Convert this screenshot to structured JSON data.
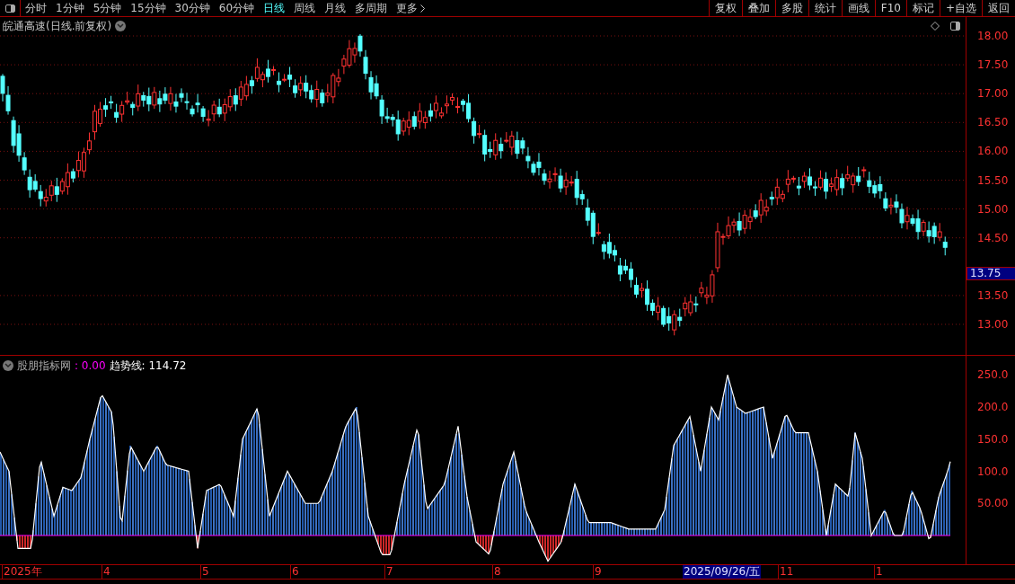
{
  "toolbar": {
    "periods": [
      {
        "label": "分时",
        "selected": false
      },
      {
        "label": "1分钟",
        "selected": false
      },
      {
        "label": "5分钟",
        "selected": false
      },
      {
        "label": "15分钟",
        "selected": false
      },
      {
        "label": "30分钟",
        "selected": false
      },
      {
        "label": "60分钟",
        "selected": false
      },
      {
        "label": "日线",
        "selected": true
      },
      {
        "label": "周线",
        "selected": false
      },
      {
        "label": "月线",
        "selected": false
      },
      {
        "label": "多周期",
        "selected": false
      },
      {
        "label": "更多",
        "selected": false
      }
    ],
    "actions": [
      "复权",
      "叠加",
      "多股",
      "统计",
      "画线",
      "F10",
      "标记",
      "+自选",
      "返回"
    ]
  },
  "chart_title": "皖通高速(日线.前复权)",
  "price_axis": {
    "ticks": [
      "18.00",
      "17.50",
      "17.00",
      "16.50",
      "16.00",
      "15.50",
      "15.00",
      "14.50",
      "13.50",
      "13.00"
    ],
    "cursor_label": "13.75"
  },
  "indicator": {
    "name": "股朋指标网",
    "series": [
      {
        "text": ": 0.00",
        "color": "#ff00ff"
      },
      {
        "text": "趋势线: 114.72",
        "color": "#ffffff"
      }
    ],
    "ticks": [
      "250.0",
      "200.0",
      "150.0",
      "100.0",
      "50.00"
    ]
  },
  "date_axis": {
    "labels": [
      "2025年",
      "4",
      "5",
      "6",
      "7",
      "8",
      "9",
      "11",
      "1"
    ],
    "cursor_label": "2025/09/26/五"
  }
}
